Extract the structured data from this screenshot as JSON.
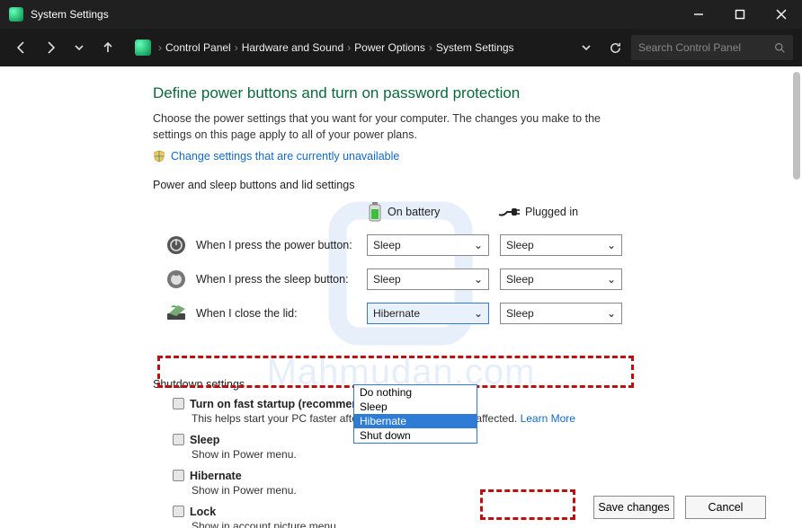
{
  "titlebar": {
    "title": "System Settings"
  },
  "breadcrumb": [
    "Control Panel",
    "Hardware and Sound",
    "Power Options",
    "System Settings"
  ],
  "search": {
    "placeholder": "Search Control Panel"
  },
  "page": {
    "heading": "Define power buttons and turn on password protection",
    "description": "Choose the power settings that you want for your computer. The changes you make to the settings on this page apply to all of your power plans.",
    "change_link": "Change settings that are currently unavailable",
    "section_label": "Power and sleep buttons and lid settings",
    "col_battery": "On battery",
    "col_plugged": "Plugged in"
  },
  "rows": {
    "power": {
      "label": "When I press the power button:",
      "battery": "Sleep",
      "plugged": "Sleep"
    },
    "sleep": {
      "label": "When I press the sleep button:",
      "battery": "Sleep",
      "plugged": "Sleep"
    },
    "lid": {
      "label": "When I close the lid:",
      "battery": "Hibernate",
      "plugged": "Sleep"
    }
  },
  "lid_options": [
    "Do nothing",
    "Sleep",
    "Hibernate",
    "Shut down"
  ],
  "lid_selected_index": 2,
  "shutdown": {
    "title": "Shutdown settings",
    "items": [
      {
        "label": "Turn on fast startup (recommended)",
        "hint": "This helps start your PC faster after shutdown. Restart isn't affected.",
        "link": "Learn More"
      },
      {
        "label": "Sleep",
        "hint": "Show in Power menu."
      },
      {
        "label": "Hibernate",
        "hint": "Show in Power menu."
      },
      {
        "label": "Lock",
        "hint": "Show in account picture menu."
      }
    ]
  },
  "footer": {
    "save": "Save changes",
    "cancel": "Cancel"
  },
  "watermark_text": "Mahmudan.com"
}
